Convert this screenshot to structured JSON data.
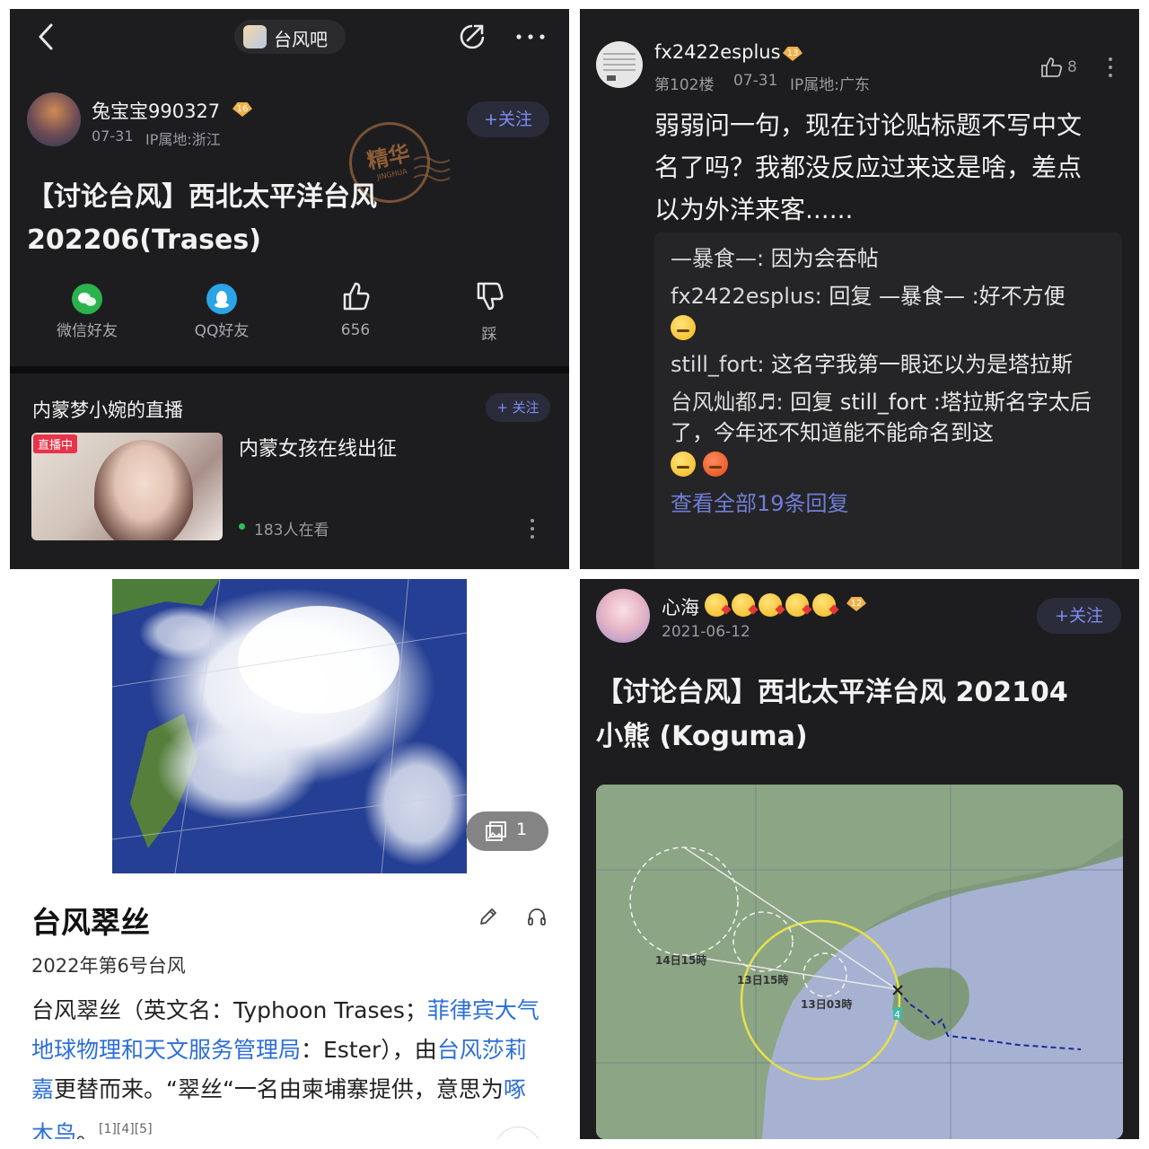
{
  "panel1": {
    "forum_name": "台风吧",
    "author": {
      "name": "兔宝宝990327",
      "level": "16",
      "date": "07-31",
      "ip": "IP属地:浙江"
    },
    "follow_label": "+关注",
    "stamp": {
      "main": "精华",
      "sub": "JINGHUA"
    },
    "title_line1": "【讨论台风】西北太平洋台风",
    "title_line2": "202206(Trases)",
    "actions": [
      {
        "label": "微信好友"
      },
      {
        "label": "QQ好友"
      },
      {
        "label": "656"
      },
      {
        "label": "踩"
      }
    ],
    "live": {
      "heading": "内蒙梦小婉的直播",
      "follow_label": "+ 关注",
      "badge": "直播中",
      "title": "内蒙女孩在线出征",
      "viewers": "183人在看"
    }
  },
  "panel2": {
    "author": {
      "name": "fx2422esplus",
      "level": "13",
      "floor": "第102楼",
      "date": "07-31",
      "ip": "IP属地:广东"
    },
    "like_count": "8",
    "body_lines": [
      "弱弱问一句，现在讨论贴标题不写中文",
      "名了吗？我都没反应过来这是啥，差点",
      "以为外洋来客......"
    ],
    "replies": [
      {
        "name": "—暴食—:",
        "text": "因为会吞帖"
      },
      {
        "name": "fx2422esplus:",
        "text": "回复 —暴食— :好不方便"
      },
      {
        "name": "still_fort:",
        "text": "这名字我第一眼还以为是塔拉斯"
      },
      {
        "name": "台风灿都♬:",
        "text": "回复 still_fort :塔拉斯名字太后了，今年还不知道能不能命名到这"
      }
    ],
    "view_all": "查看全部19条回复"
  },
  "panel3": {
    "image_count": "1",
    "title": "台风翠丝",
    "subtitle": "2022年第6号台风",
    "para": {
      "t1": "台风翠丝（英文名：Typhoon Trases；",
      "l1": "菲律宾大气地球物理和天文服务管理局",
      "t2": "：Ester），由",
      "l2": "台风莎莉嘉",
      "t3": "更替而来。“翠丝“一名由柬埔寨提供，意思为",
      "l3": "啄木鸟",
      "t4": "。",
      "refs": "[1][4][5]"
    }
  },
  "panel4": {
    "author": {
      "name": "心海",
      "level": "12",
      "date": "2021-06-12"
    },
    "follow_label": "+关注",
    "title_line1": "【讨论台风】西北太平洋台风 202104",
    "title_line2": "小熊 (Koguma)",
    "map_labels": {
      "a": "14日15時",
      "b": "13日15時",
      "c": "13日03時",
      "d": "4"
    }
  },
  "colors": {
    "accent": "#7f8cf0",
    "link": "#2d6fd6",
    "live_red": "#e8334a"
  }
}
